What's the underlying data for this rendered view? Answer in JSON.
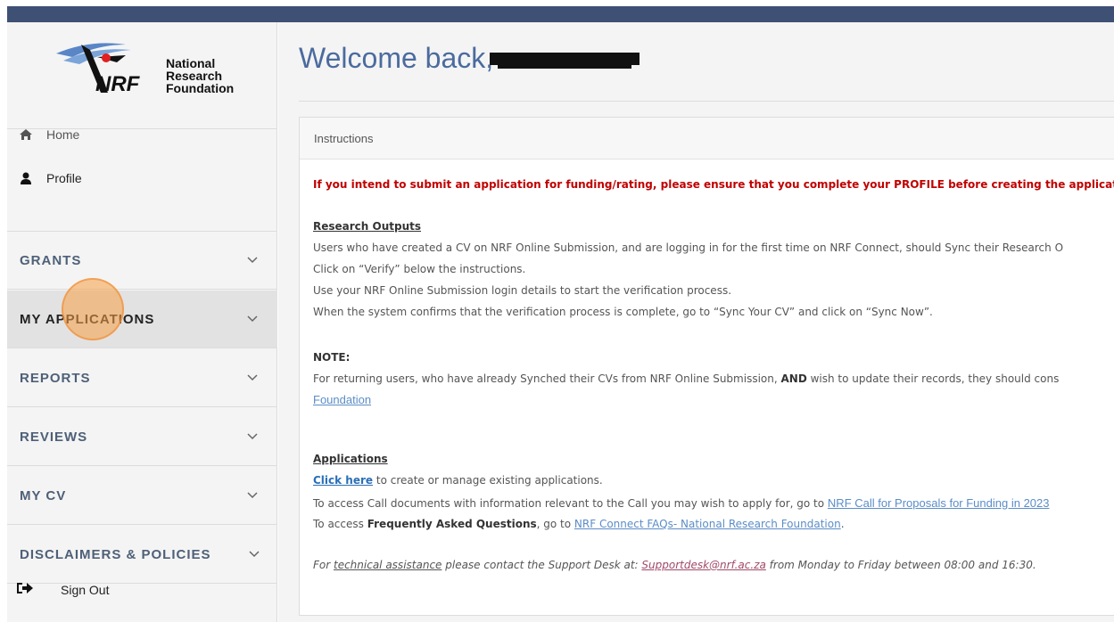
{
  "logo": {
    "line1": "National",
    "line2": "Research",
    "line3": "Foundation",
    "mark": "NRF"
  },
  "nav": {
    "home": "Home",
    "profile": "Profile",
    "sign_out": "Sign Out"
  },
  "sections": [
    {
      "label": "GRANTS"
    },
    {
      "label": "MY APPLICATIONS"
    },
    {
      "label": "REPORTS"
    },
    {
      "label": "REVIEWS"
    },
    {
      "label": "MY CV"
    },
    {
      "label": "DISCLAIMERS & POLICIES"
    }
  ],
  "header": {
    "welcome": "Welcome back,"
  },
  "panel": {
    "title": "Instructions",
    "warning": "If you intend to submit an application for funding/rating, please ensure that you complete your PROFILE before creating the applicatio",
    "research_heading": "Research Outputs",
    "r1": "Users who have created a CV on NRF Online Submission, and are logging in for the first time on NRF Connect, should Sync their Research O",
    "r2": "Click on “Verify” below the instructions.",
    "r3": "Use your NRF Online Submission login details to start the verification process.",
    "r4": "When the system confirms that the verification process is complete, go to “Sync Your CV” and click on “Sync Now”.",
    "note_heading": "NOTE:",
    "note_pre": "For returning users, who have already Synched their CVs from NRF Online Submission, ",
    "note_and": "AND",
    "note_post": " wish to update their records, they should cons",
    "note_link": "Foundation",
    "apps_heading": "Applications",
    "click_here": "Click here",
    "apps_1": " to create or manage existing applications.",
    "apps_2_pre": "To access Call documents with information relevant to the Call you may wish to apply for, go to ",
    "apps_2_link": "NRF Call for Proposals for Funding in 2023",
    "apps_3_pre": "To access ",
    "apps_3_bold": "Frequently Asked Questions",
    "apps_3_mid": ", go to ",
    "apps_3_link": "NRF Connect FAQs- National Research Foundation",
    "apps_3_end": ".",
    "support_pre": "For ",
    "support_tech": "technical assistance",
    "support_mid": " please contact the Support Desk at: ",
    "support_email": "Supportdesk@nrf.ac.za",
    "support_end": " from Monday to Friday between 08:00 and 16:30."
  }
}
